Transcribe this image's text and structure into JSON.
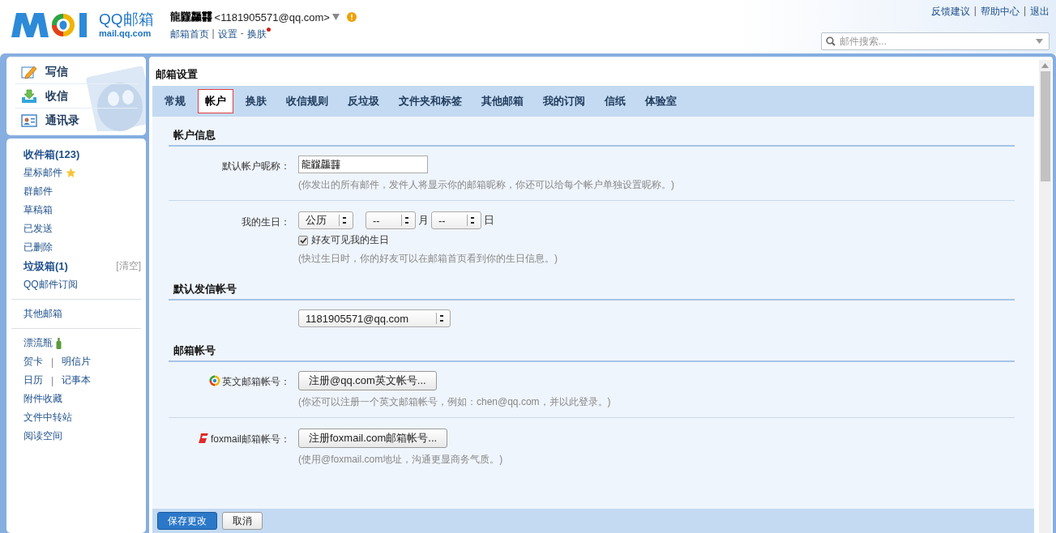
{
  "header": {
    "logo": {
      "title": "QQ邮箱",
      "domain": "mail.qq.com"
    },
    "user": {
      "name": "龍龖龘䨻",
      "email": "<1181905571@qq.com>",
      "warning": true
    },
    "user_links": [
      {
        "label": "邮箱首页",
        "badge": false
      },
      {
        "separator": "|",
        "label": "设置",
        "badge": false
      },
      {
        "separator": "-",
        "label": "换肤",
        "badge": true
      }
    ],
    "top_links": [
      {
        "label": "反馈建议"
      },
      {
        "separator": "|",
        "label": "帮助中心"
      },
      {
        "separator": "|",
        "label": "退出"
      }
    ],
    "search": {
      "placeholder": "邮件搜索..."
    }
  },
  "sidebar": {
    "actions": [
      {
        "label": "写信",
        "kind": "write"
      },
      {
        "label": "收信",
        "kind": "receive"
      },
      {
        "label": "通讯录",
        "kind": "contacts"
      }
    ],
    "groups": [
      [
        {
          "label": "收件箱(123)",
          "bold": true
        },
        {
          "label": "星标邮件",
          "bold": false,
          "kind": "star"
        },
        {
          "label": "群邮件",
          "bold": false
        },
        {
          "label": "草稿箱",
          "bold": false
        },
        {
          "label": "已发送",
          "bold": false
        },
        {
          "label": "已删除",
          "bold": false
        },
        {
          "label": "垃圾箱(1)",
          "bold": true,
          "action": "[清空]"
        },
        {
          "label": "QQ邮件订阅",
          "bold": false
        }
      ],
      [
        {
          "label": "其他邮箱",
          "bold": false
        }
      ],
      [
        {
          "label": "漂流瓶",
          "bold": false,
          "kind": "bottle"
        },
        {
          "label": "贺卡",
          "bold": false,
          "separator": "|",
          "label2": "明信片"
        },
        {
          "label": "日历",
          "bold": false,
          "separator": "|",
          "label2": "记事本"
        },
        {
          "label": "附件收藏",
          "bold": false
        },
        {
          "label": "文件中转站",
          "bold": false
        },
        {
          "label": "阅读空间",
          "bold": false
        }
      ]
    ]
  },
  "settings": {
    "title": "邮箱设置",
    "tabs": [
      {
        "label": "常规",
        "selected": false
      },
      {
        "label": "帐户",
        "selected": true
      },
      {
        "label": "换肤",
        "selected": false
      },
      {
        "label": "收信规则",
        "selected": false
      },
      {
        "label": "反垃圾",
        "selected": false
      },
      {
        "label": "文件夹和标签",
        "selected": false
      },
      {
        "label": "其他邮箱",
        "selected": false
      },
      {
        "label": "我的订阅",
        "selected": false
      },
      {
        "label": "信纸",
        "selected": false
      },
      {
        "label": "体验室",
        "selected": false
      }
    ],
    "sections": [
      {
        "heading": "帐户信息",
        "rows": [
          {
            "kind": "text",
            "label": "默认帐户昵称：",
            "value": "龍龖龘䨻",
            "hint": "(你发出的所有邮件，发件人将显示你的邮箱昵称，你还可以给每个帐户单独设置昵称。)"
          },
          {
            "kind": "birthday",
            "label": "我的生日：",
            "calendar": "公历",
            "month": "--",
            "month_unit": "月",
            "day": "--",
            "day_unit": "日",
            "checkbox": {
              "label": "好友可见我的生日",
              "checked": true
            },
            "hint": "(快过生日时，你的好友可以在邮箱首页看到你的生日信息。)"
          }
        ]
      },
      {
        "heading": "默认发信帐号",
        "rows": [
          {
            "kind": "select",
            "value": "1181905571@qq.com"
          }
        ]
      },
      {
        "heading": "邮箱帐号",
        "rows": [
          {
            "kind": "qq-account",
            "label": "英文邮箱帐号：",
            "button": "注册@qq.com英文帐号...",
            "hint": "(你还可以注册一个英文邮箱帐号，例如：chen@qq.com，并以此登录。)"
          },
          {
            "kind": "foxmail-account",
            "label": "foxmail邮箱帐号：",
            "button": "注册foxmail.com邮箱帐号...",
            "hint": "(使用@foxmail.com地址，沟通更显商务气质。)"
          }
        ]
      }
    ],
    "footer": [
      {
        "label": "保存更改",
        "kind": "primary"
      },
      {
        "label": "取消",
        "kind": "default"
      }
    ]
  }
}
